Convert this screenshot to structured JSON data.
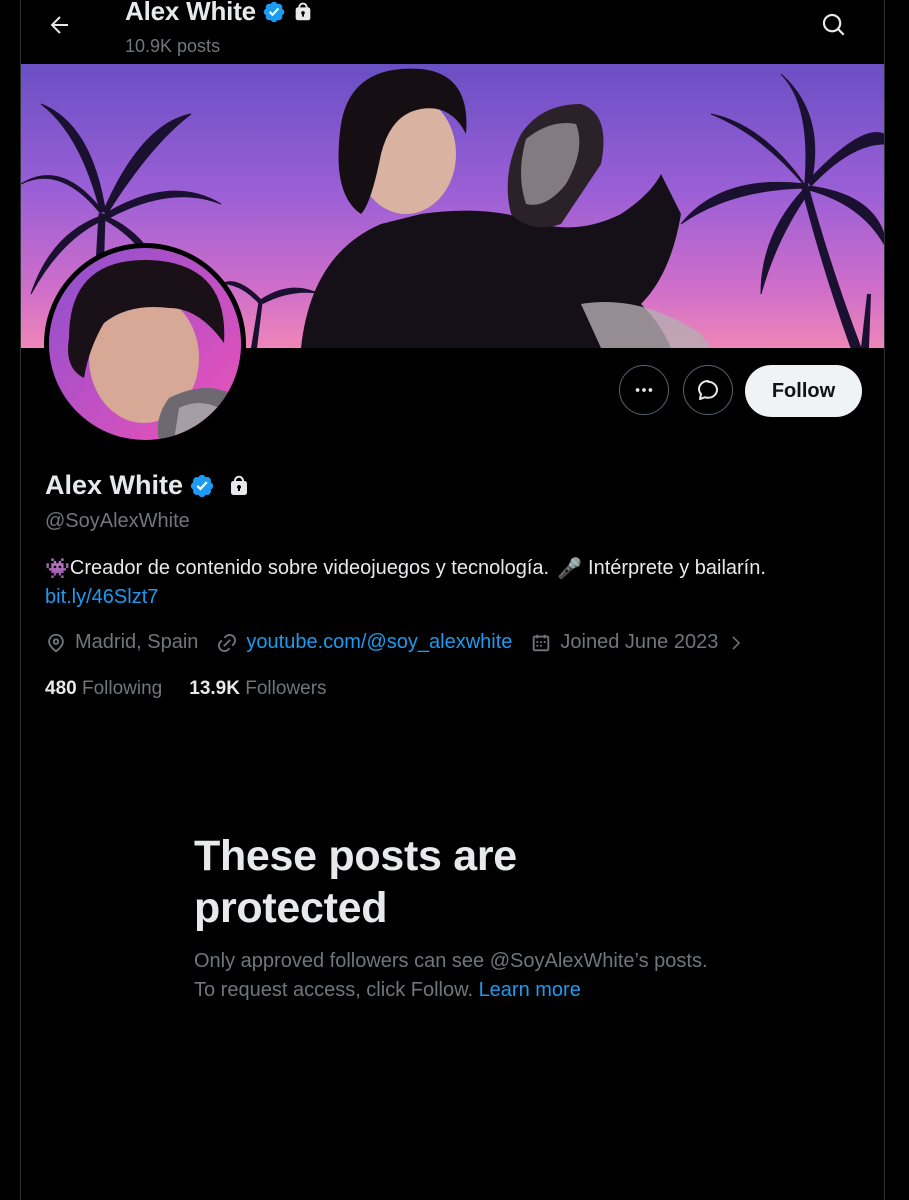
{
  "header": {
    "name": "Alex White",
    "posts_count": "10.9K posts"
  },
  "actions": {
    "follow_label": "Follow"
  },
  "profile": {
    "display_name": "Alex White",
    "handle": "@SoyAlexWhite",
    "bio_emoji_1": "👾",
    "bio_part_1": "Creador de contenido sobre videojuegos y tecnología.",
    "bio_emoji_2": "🎤",
    "bio_part_2": "Intérprete y bailarín.",
    "bio_link": "bit.ly/46Slzt7",
    "location": "Madrid, Spain",
    "website": "youtube.com/@soy_alexwhite",
    "joined": "Joined June 2023",
    "following_count": "480",
    "following_label": "Following",
    "followers_count": "13.9K",
    "followers_label": "Followers"
  },
  "protected": {
    "title": "These posts are protected",
    "message": "Only approved followers can see @SoyAlexWhite’s posts. To request access, click Follow.",
    "learn_more": "Learn more"
  },
  "icons": {
    "back": "arrow-left-icon",
    "search": "search-icon",
    "verified": "verified-badge-icon",
    "lock": "lock-icon",
    "more": "more-dots-icon",
    "message": "message-icon",
    "location": "location-pin-icon",
    "link": "link-icon",
    "calendar": "calendar-icon",
    "chevron": "chevron-right-icon"
  },
  "colors": {
    "background": "#000000",
    "accent": "#1d9bf0",
    "text_primary": "#e7e9ea",
    "text_secondary": "#71767b",
    "follow_button_bg": "#eff3f4"
  }
}
